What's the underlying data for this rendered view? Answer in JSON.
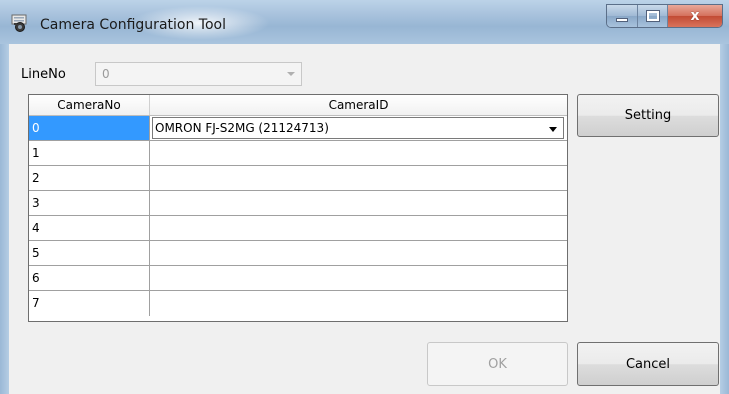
{
  "window": {
    "title": "Camera Configuration Tool",
    "minimize_label": "",
    "maximize_label": "",
    "close_label": "x"
  },
  "lineno": {
    "label": "LineNo",
    "value": "0"
  },
  "grid": {
    "headers": [
      "CameraNo",
      "CameraID"
    ],
    "rows": [
      {
        "camera_no": "0",
        "camera_id": "OMRON FJ-S2MG (21124713)"
      },
      {
        "camera_no": "1",
        "camera_id": ""
      },
      {
        "camera_no": "2",
        "camera_id": ""
      },
      {
        "camera_no": "3",
        "camera_id": ""
      },
      {
        "camera_no": "4",
        "camera_id": ""
      },
      {
        "camera_no": "5",
        "camera_id": ""
      },
      {
        "camera_no": "6",
        "camera_id": ""
      },
      {
        "camera_no": "7",
        "camera_id": ""
      }
    ]
  },
  "buttons": {
    "setting": "Setting",
    "ok": "OK",
    "cancel": "Cancel"
  },
  "colors": {
    "selection": "#3399ff",
    "titlebar": "#a7c1dc",
    "close": "#c24b34"
  }
}
